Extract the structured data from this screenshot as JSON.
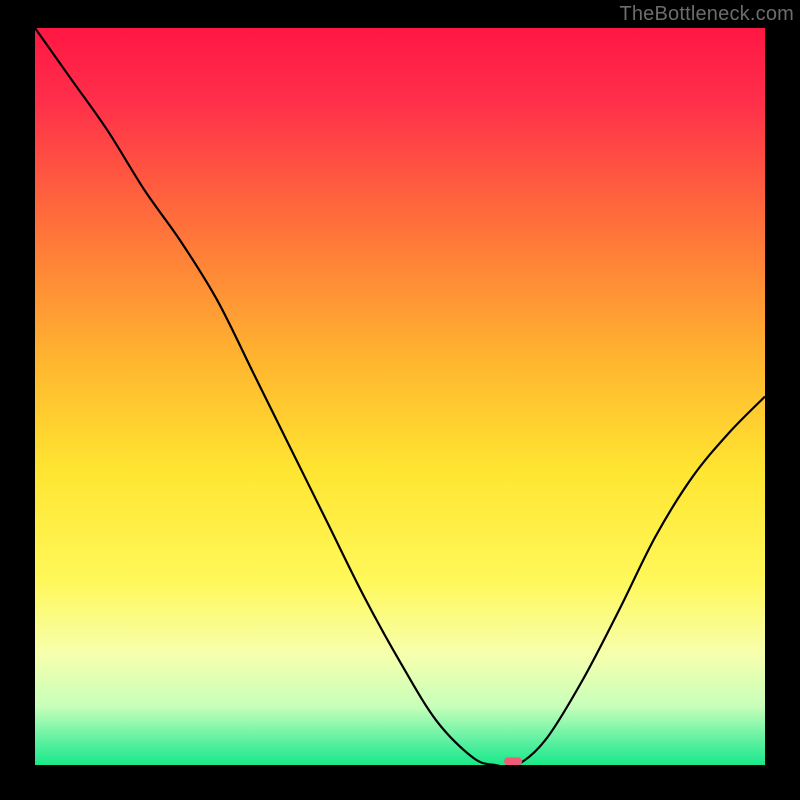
{
  "watermark": "TheBottleneck.com",
  "chart_data": {
    "type": "line",
    "title": "",
    "xlabel": "",
    "ylabel": "",
    "xlim": [
      0,
      100
    ],
    "ylim": [
      0,
      100
    ],
    "x": [
      0,
      5,
      10,
      15,
      20,
      25,
      30,
      35,
      40,
      45,
      50,
      55,
      60,
      63,
      66,
      70,
      75,
      80,
      85,
      90,
      95,
      100
    ],
    "values": [
      100,
      93,
      86,
      78,
      71,
      63,
      53,
      43,
      33,
      23,
      14,
      6,
      1,
      0,
      0,
      3.5,
      11.5,
      21,
      31,
      39,
      45,
      50
    ],
    "minimum_plateau": {
      "x_start": 62,
      "x_end": 67,
      "y": 0
    },
    "highlight_point": {
      "x": 65.5,
      "y": 0.5,
      "color": "#f05b78"
    },
    "gradient_stops": [
      {
        "stop": 0.0,
        "color": "#ff1744"
      },
      {
        "stop": 0.1,
        "color": "#ff2f4a"
      },
      {
        "stop": 0.25,
        "color": "#ff6a3c"
      },
      {
        "stop": 0.45,
        "color": "#ffb52f"
      },
      {
        "stop": 0.6,
        "color": "#ffe531"
      },
      {
        "stop": 0.75,
        "color": "#fff85a"
      },
      {
        "stop": 0.85,
        "color": "#f6ffad"
      },
      {
        "stop": 0.92,
        "color": "#c8ffba"
      },
      {
        "stop": 0.97,
        "color": "#57f0a0"
      },
      {
        "stop": 1.0,
        "color": "#19e889"
      }
    ]
  }
}
